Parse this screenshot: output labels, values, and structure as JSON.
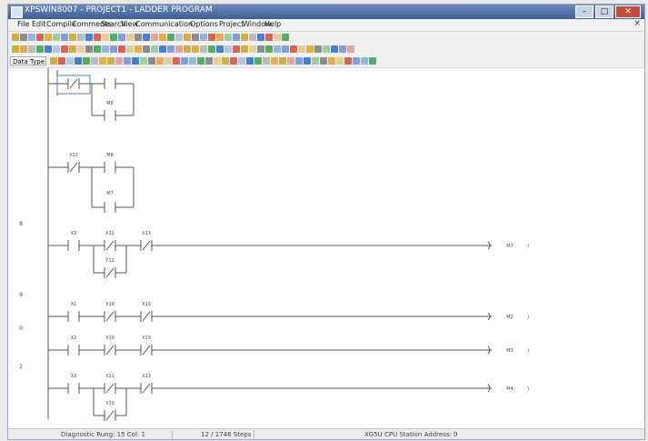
{
  "window": {
    "title": "XPSWIN8007 - PROJECT1 - LADDER PROGRAM"
  },
  "window_controls": {
    "minimize": "–",
    "maximize": "□",
    "close": "✕"
  },
  "menubar": {
    "items": [
      "File",
      "Edit",
      "Compile",
      "Comments",
      "Search",
      "View",
      "Communication",
      "Options",
      "Project",
      "Window",
      "Help"
    ],
    "close_glyph": "×"
  },
  "toolbars": {
    "data_type_label": "Data Type",
    "colors": [
      "#2a6cc4",
      "#c9a227",
      "#39a04a",
      "#d14b3c",
      "#7a7a7a",
      "#6b8fd6",
      "#e0a030"
    ]
  },
  "ladder": {
    "rungs": [
      {
        "number": "",
        "contacts": [
          "X",
          ""
        ],
        "labels": [
          "",
          ""
        ],
        "branch": [
          "M8"
        ],
        "coil": ""
      },
      {
        "number": "",
        "contacts": [
          "NC",
          "NO"
        ],
        "labels": [
          "X12",
          "M8"
        ],
        "branch": [
          "M7"
        ],
        "coil": ""
      },
      {
        "number": "8",
        "contacts": [
          "NO",
          "NC",
          "NC"
        ],
        "labels": [
          "X3",
          "X11",
          "X13"
        ],
        "branch": [
          "Y12"
        ],
        "coil": "M7"
      },
      {
        "number": "9",
        "contacts": [
          "NO",
          "NC",
          "NC"
        ],
        "labels": [
          "X1",
          "X10",
          "X13"
        ],
        "branch": [],
        "coil": "M2"
      },
      {
        "number": "0",
        "contacts": [
          "NO",
          "NC",
          "NC"
        ],
        "labels": [
          "X2",
          "X10",
          "X13"
        ],
        "branch": [],
        "coil": "M3"
      },
      {
        "number": "2",
        "contacts": [
          "NO",
          "NC",
          "NC"
        ],
        "labels": [
          "X3",
          "X11",
          "X13"
        ],
        "branch": [
          "X10"
        ],
        "coil": "M4"
      }
    ],
    "coil_suffix": ")"
  },
  "status": {
    "left": "Diagnostic Rung: 15 Col: 1",
    "middle": "12 / 1746 Steps",
    "right": "XG5U CPU Station Address: 0"
  }
}
